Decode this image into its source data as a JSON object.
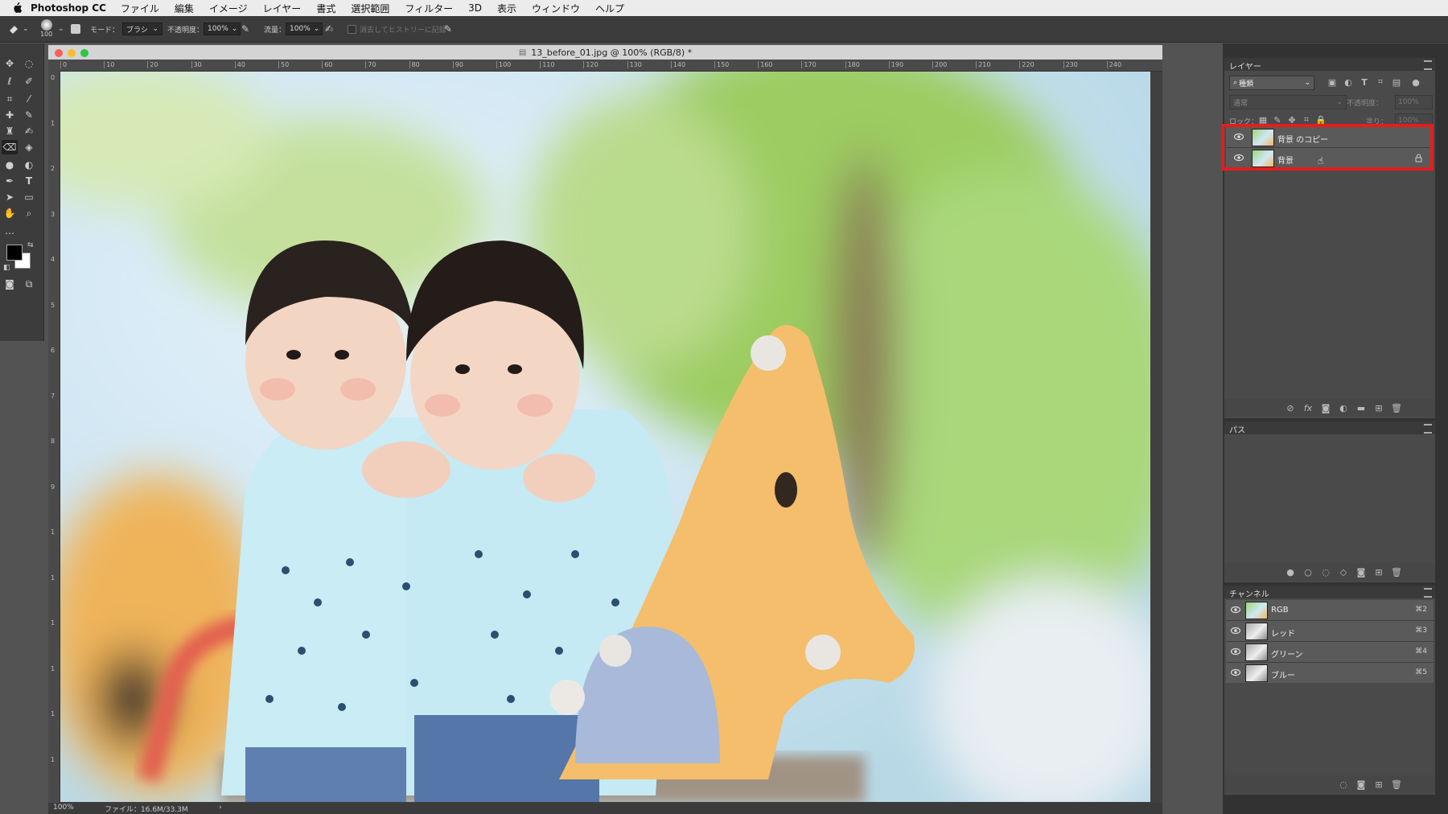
{
  "menubar": {
    "app_name": "Photoshop CC",
    "items": [
      "ファイル",
      "編集",
      "イメージ",
      "レイヤー",
      "書式",
      "選択範囲",
      "フィルター",
      "3D",
      "表示",
      "ウィンドウ",
      "ヘルプ"
    ]
  },
  "options": {
    "brush_size": "100",
    "mode_label": "モード：",
    "mode_value": "ブラシ",
    "opacity_label": "不透明度：",
    "opacity_value": "100%",
    "flow_label": "流量：",
    "flow_value": "100%",
    "history_label": "消去してヒストリーに記録"
  },
  "document": {
    "title": "13_before_01.jpg @ 100% (RGB/8) *",
    "zoom": "100%",
    "file_info": "ファイル：16.6M/33.3M",
    "h_ruler": [
      "0",
      "10",
      "20",
      "30",
      "40",
      "50",
      "60",
      "70",
      "80",
      "90",
      "100",
      "110",
      "120",
      "130",
      "140",
      "150",
      "160",
      "170",
      "180",
      "190",
      "200",
      "210",
      "220",
      "230",
      "240"
    ],
    "v_ruler": [
      "0",
      "1",
      "2",
      "3",
      "4",
      "5",
      "6",
      "7",
      "8",
      "9",
      "1",
      "1",
      "1",
      "1",
      "1",
      "1"
    ]
  },
  "layers_panel": {
    "tab": "レイヤー",
    "kind_filter": "種類",
    "blend_mode": "通常",
    "opacity_label": "不透明度：",
    "opacity_value": "100%",
    "lock_label": "ロック：",
    "fill_label": "塗り：",
    "fill_value": "100%",
    "layers": [
      {
        "name": "背景 のコピー"
      },
      {
        "name": "背景"
      }
    ],
    "highlight_color": "#e81c1c"
  },
  "paths_panel": {
    "tab": "パス"
  },
  "channels_panel": {
    "tab": "チャンネル",
    "channels": [
      {
        "name": "RGB",
        "shortcut": "⌘2"
      },
      {
        "name": "レッド",
        "shortcut": "⌘3"
      },
      {
        "name": "グリーン",
        "shortcut": "⌘4"
      },
      {
        "name": "ブルー",
        "shortcut": "⌘5"
      }
    ]
  }
}
